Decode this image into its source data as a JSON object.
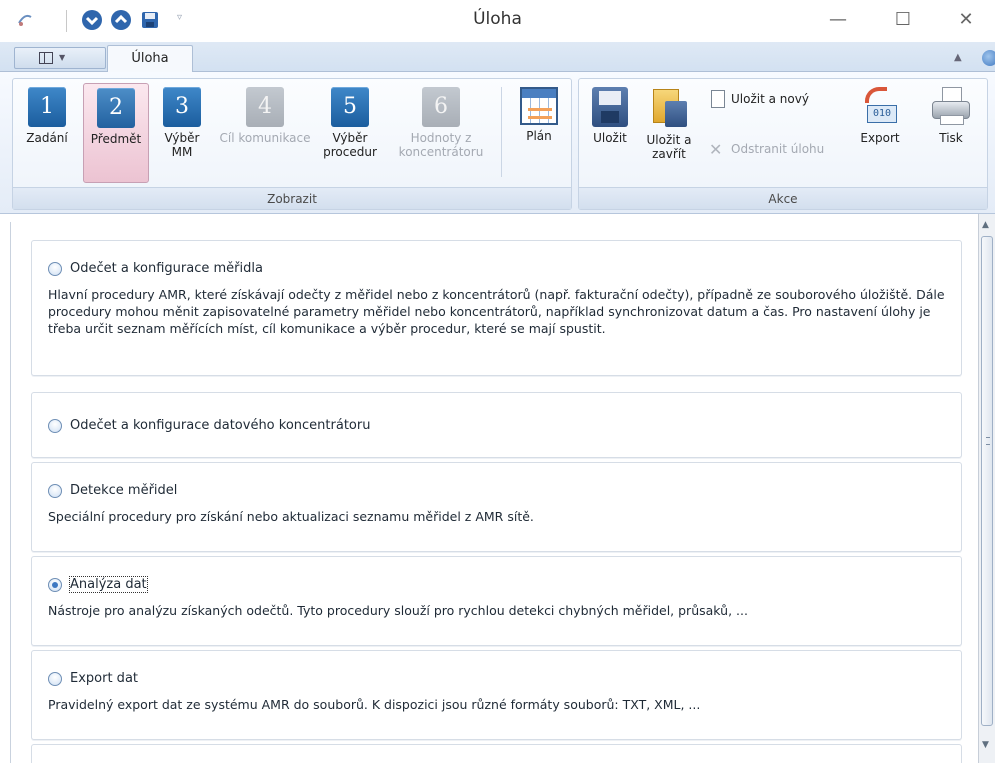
{
  "window": {
    "title": "Úloha",
    "controls": {
      "minimize": "—",
      "maximize": "☐",
      "close": "✕"
    }
  },
  "quick_access": {
    "items": [
      "arrow-down-icon",
      "arrow-up-icon",
      "save-icon"
    ],
    "more": "▿"
  },
  "ribbon": {
    "active_tab": "Úloha",
    "groups": {
      "zobrazit": {
        "label": "Zobrazit",
        "buttons": [
          {
            "number": "1",
            "label": "Zadání",
            "enabled": true
          },
          {
            "number": "2",
            "label": "Předmět",
            "enabled": true,
            "selected": true
          },
          {
            "number": "3",
            "label": "Výběr MM",
            "enabled": true
          },
          {
            "number": "4",
            "label": "Cíl komunikace",
            "enabled": false
          },
          {
            "number": "5",
            "label": "Výběr procedur",
            "enabled": true
          },
          {
            "number": "6",
            "label": "Hodnoty z koncentrátoru",
            "enabled": false
          },
          {
            "label": "Plán",
            "icon": "calendar-icon",
            "enabled": true
          }
        ]
      },
      "akce": {
        "label": "Akce",
        "buttons": {
          "ulozit": "Uložit",
          "ulozit_a_zavrit": "Uložit a zavřít",
          "ulozit_a_novy": "Uložit a nový",
          "odstranit_ulohu": "Odstranit úlohu",
          "export": "Export",
          "export_icon_text": "010",
          "tisk": "Tisk"
        }
      }
    }
  },
  "tasks": [
    {
      "title": "Odečet a konfigurace měřidla",
      "description": "Hlavní procedury AMR, které získávají odečty z měřidel nebo z koncentrátorů (např. fakturační odečty), případně ze souborového úložiště. Dále procedury mohou měnit zapisovatelné parametry měřidel nebo koncentrátorů, například synchronizovat datum a čas. Pro nastavení úlohy je třeba určit seznam měřících míst, cíl komunikace a výběr procedur, které se mají spustit.",
      "selected": false
    },
    {
      "title": "Odečet a konfigurace datového koncentrátoru",
      "description": "",
      "selected": false
    },
    {
      "title": "Detekce měřidel",
      "description": "Speciální procedury pro získání nebo aktualizaci seznamu měřidel z AMR sítě.",
      "selected": false
    },
    {
      "title": "Analýza dat",
      "description": "Nástroje pro analýzu získaných odečtů. Tyto procedury slouží pro rychlou detekci chybných měřidel, průsaků, ...",
      "selected": true
    },
    {
      "title": "Export dat",
      "description": "Pravidelný export dat ze systému AMR do souborů. K dispozici jsou různé formáty souborů: TXT, XML, ...",
      "selected": false
    }
  ]
}
